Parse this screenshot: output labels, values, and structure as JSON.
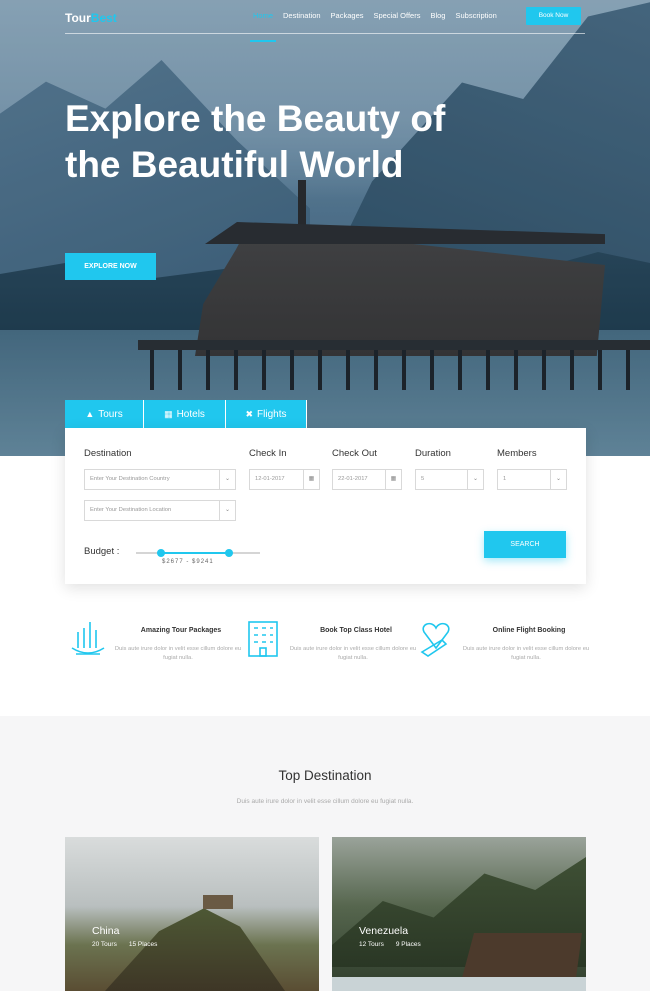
{
  "colors": {
    "accent": "#20c7ee",
    "dark_text": "#333333",
    "muted_text": "#aaaaaa"
  },
  "nav": {
    "logo_part1": "Tour",
    "logo_part2": "Best",
    "items": [
      "Home",
      "Destination",
      "Packages",
      "Special Offers",
      "Blog",
      "Subscription"
    ],
    "active": "Home",
    "book_label": "Book Now"
  },
  "hero": {
    "title": "Explore the Beauty of the Beautiful World",
    "cta": "EXPLORE NOW"
  },
  "search": {
    "tabs": [
      {
        "label": "Tours",
        "icon": "tree-icon"
      },
      {
        "label": "Hotels",
        "icon": "building-icon"
      },
      {
        "label": "Flights",
        "icon": "plane-icon"
      }
    ],
    "destination_label": "Destination",
    "destination_placeholder": "Enter Your Destination Country",
    "location_placeholder": "Enter Your Destination Location",
    "checkin_label": "Check In",
    "checkin_value": "12-01-2017",
    "checkout_label": "Check Out",
    "checkout_value": "22-01-2017",
    "duration_label": "Duration",
    "duration_value": "5",
    "members_label": "Members",
    "members_value": "1",
    "budget_label": "Budget :",
    "budget_min": "$2677",
    "budget_max": "$9241",
    "budget_range_text": "$2677 - $9241",
    "slider_low_fraction": 0.2,
    "slider_high_fraction": 0.75,
    "search_label": "SEARCH"
  },
  "features": [
    {
      "title": "Amazing Tour Packages",
      "desc": "Duis aute irure dolor in velit esse cillum dolore eu fugiat nulla.",
      "icon": "tour-package-icon"
    },
    {
      "title": "Book Top Class Hotel",
      "desc": "Duis aute irure dolor in velit esse cillum dolore eu fugiat nulla.",
      "icon": "hotel-icon"
    },
    {
      "title": "Online Flight Booking",
      "desc": "Duis aute irure dolor in velit esse cillum dolore eu fugiat nulla.",
      "icon": "flight-booking-icon"
    }
  ],
  "destinations": {
    "title": "Top Destination",
    "subtitle": "Duis aute irure dolor in velit esse cillum dolore eu fugiat nulla.",
    "cards": [
      {
        "name": "China",
        "tours": "20 Tours",
        "places": "15 Places"
      },
      {
        "name": "Venezuela",
        "tours": "12 Tours",
        "places": "9 Places"
      }
    ]
  }
}
